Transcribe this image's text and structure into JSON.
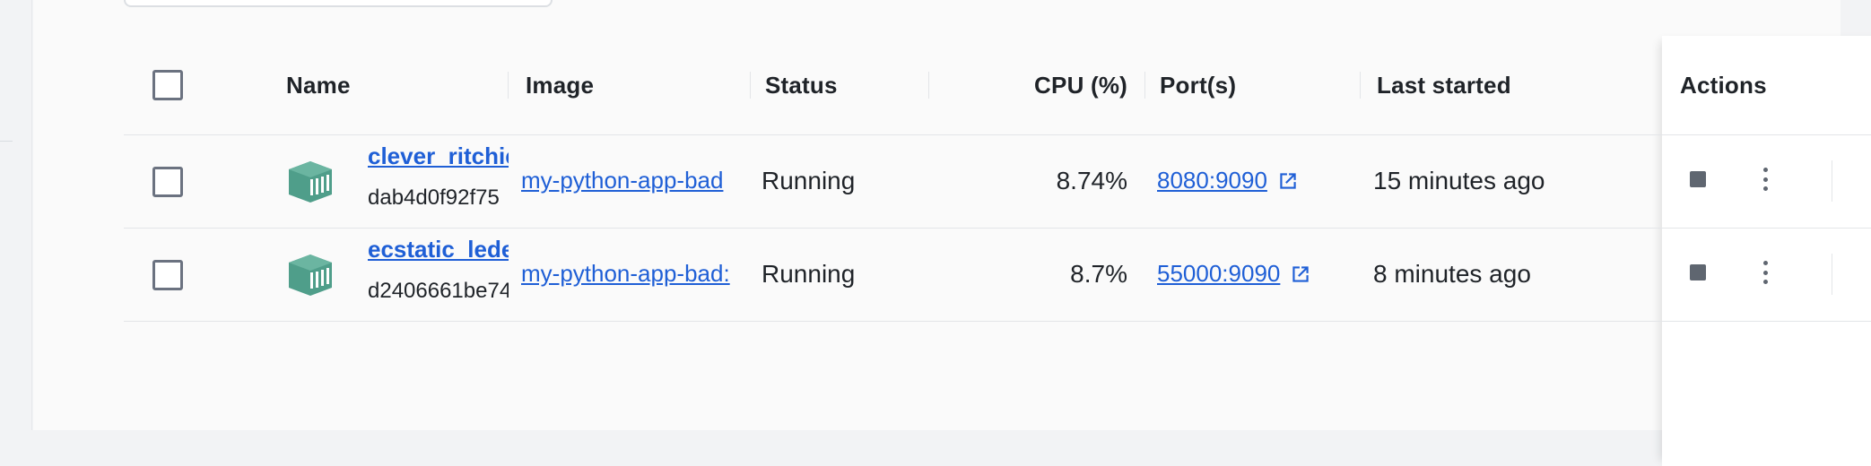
{
  "table": {
    "columns": {
      "name": "Name",
      "image": "Image",
      "status": "Status",
      "cpu": "CPU (%)",
      "ports": "Port(s)",
      "last_started": "Last started",
      "actions": "Actions"
    },
    "rows": [
      {
        "name": "clever_ritchie",
        "id": "dab4d0f92f75",
        "image": "my-python-app-bad",
        "status": "Running",
        "cpu": "8.74%",
        "ports": "8080:9090",
        "last_started": "15 minutes ago"
      },
      {
        "name": "ecstatic_leder",
        "id": "d2406661be74",
        "image": "my-python-app-bad:",
        "status": "Running",
        "cpu": "8.7%",
        "ports": "55000:9090",
        "last_started": "8 minutes ago"
      }
    ]
  },
  "icons": {
    "container": "container-cube-icon",
    "external_link": "external-link-icon",
    "stop": "stop-icon",
    "more": "more-vertical-icon",
    "delete": "trash-icon"
  },
  "colors": {
    "link": "#1f5fd6",
    "container_icon": "#4f9e8a",
    "action_icon": "#5f6670"
  }
}
